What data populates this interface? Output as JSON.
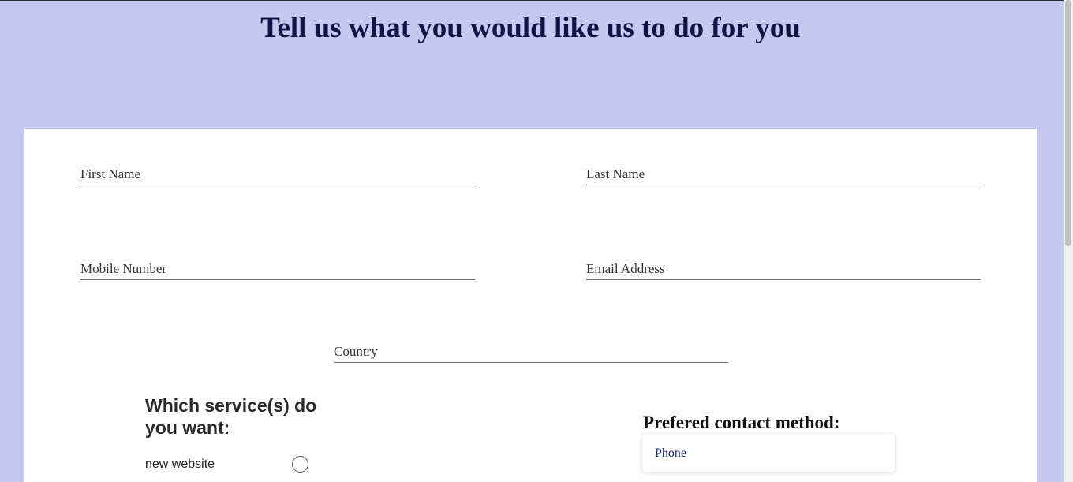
{
  "header": {
    "title": "Tell us what you would like us to do for you"
  },
  "form": {
    "first_name": {
      "placeholder": "First Name",
      "value": ""
    },
    "last_name": {
      "placeholder": "Last Name",
      "value": ""
    },
    "mobile_number": {
      "placeholder": "Mobile Number",
      "value": ""
    },
    "email_address": {
      "placeholder": "Email Address",
      "value": ""
    },
    "country": {
      "placeholder": "Country",
      "value": ""
    }
  },
  "services": {
    "heading": "Which service(s) do you want:",
    "options": [
      {
        "label": "new website",
        "selected": false
      }
    ]
  },
  "contact": {
    "heading": "Prefered contact method:",
    "selected": "Phone"
  },
  "colors": {
    "page_background": "#c5c9ef",
    "card_background": "#ffffff",
    "title_color": "#0f1443",
    "option_text": "#1d2470"
  }
}
